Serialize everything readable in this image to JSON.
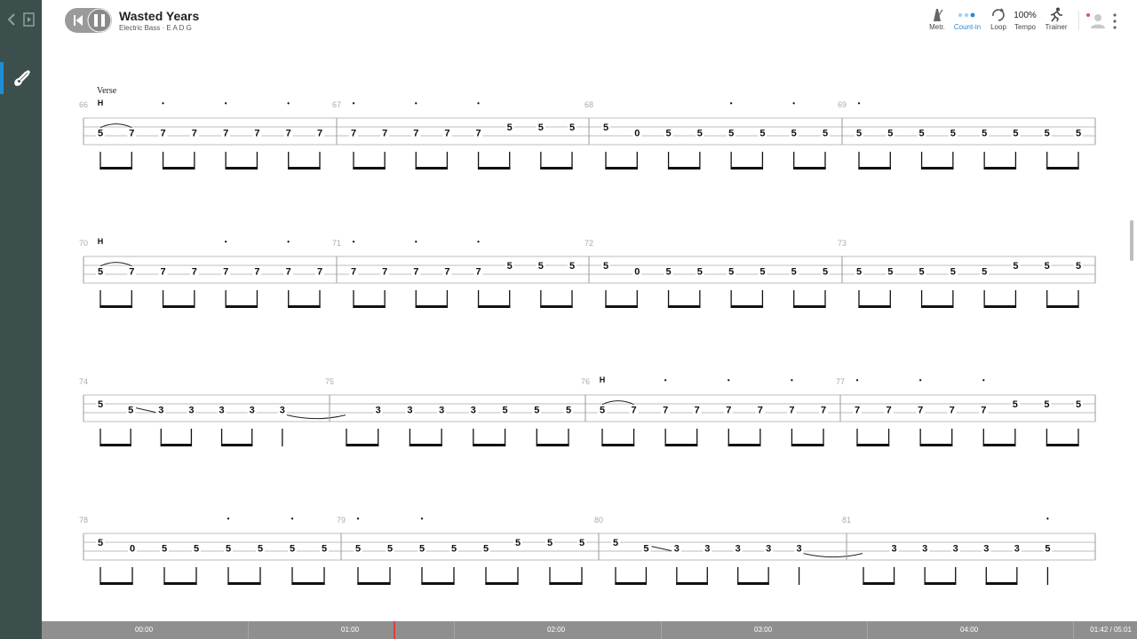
{
  "song": {
    "title": "Wasted Years",
    "subtitle": "Electric Bass · E A D G"
  },
  "toolbar": {
    "metronome": "Metr.",
    "count_in": "Count-in",
    "loop": "Loop",
    "tempo_value": "100%",
    "tempo": "Tempo",
    "trainer": "Trainer"
  },
  "timeline": {
    "labels": [
      "00:00",
      "01:00",
      "02:00",
      "03:00",
      "04:00"
    ],
    "position": "01:42 / 05:01"
  },
  "colors": {
    "sidebar": "#3d4f4c",
    "accent": "#1e8fd6",
    "timeline": "#8f8f8f",
    "playhead": "#e03a3a"
  },
  "icons": [
    "back-arrow-icon",
    "panel-icon",
    "bass-guitar-icon",
    "skip-back-icon",
    "pause-icon",
    "metronome-icon",
    "count-in-icon",
    "loop-icon",
    "trainer-runner-icon",
    "avatar-icon",
    "more-vertical-icon"
  ],
  "score": {
    "systems": [
      {
        "section": "Verse",
        "measures": [
          {
            "number": "66",
            "notes": [
              [
                "5",
                2
              ],
              [
                "7",
                2
              ],
              [
                "7",
                2
              ],
              [
                "7",
                2
              ],
              [
                "7",
                2
              ],
              [
                "7",
                2
              ],
              [
                "7",
                2
              ],
              [
                "7",
                2
              ]
            ],
            "techniques": [
              [
                0,
                "H"
              ],
              [
                2,
                "•"
              ],
              [
                4,
                "•"
              ],
              [
                6,
                "•"
              ]
            ],
            "ties": [
              [
                0,
                1
              ]
            ],
            "beams": [
              2,
              2,
              2,
              2
            ]
          },
          {
            "number": "67",
            "notes": [
              [
                "7",
                2
              ],
              [
                "7",
                2
              ],
              [
                "7",
                2
              ],
              [
                "7",
                2
              ],
              [
                "7",
                2
              ],
              [
                "5",
                1
              ],
              [
                "5",
                1
              ],
              [
                "5",
                1
              ]
            ],
            "techniques": [
              [
                0,
                "•"
              ],
              [
                2,
                "•"
              ],
              [
                4,
                "•"
              ]
            ],
            "beams": [
              2,
              2,
              2,
              2
            ]
          },
          {
            "number": "68",
            "notes": [
              [
                "5",
                1
              ],
              [
                "0",
                2
              ],
              [
                "5",
                2
              ],
              [
                "5",
                2
              ],
              [
                "5",
                2
              ],
              [
                "5",
                2
              ],
              [
                "5",
                2
              ],
              [
                "5",
                2
              ]
            ],
            "techniques": [
              [
                4,
                "•"
              ],
              [
                6,
                "•"
              ]
            ],
            "beams": [
              2,
              2,
              2,
              2
            ]
          },
          {
            "number": "69",
            "notes": [
              [
                "5",
                2
              ],
              [
                "5",
                2
              ],
              [
                "5",
                2
              ],
              [
                "5",
                2
              ],
              [
                "5",
                2
              ],
              [
                "5",
                2
              ],
              [
                "5",
                2
              ],
              [
                "5",
                2
              ]
            ],
            "techniques": [
              [
                0,
                "•"
              ]
            ],
            "beams": [
              2,
              2,
              2,
              2
            ]
          }
        ]
      },
      {
        "measures": [
          {
            "number": "70",
            "notes": [
              [
                "5",
                2
              ],
              [
                "7",
                2
              ],
              [
                "7",
                2
              ],
              [
                "7",
                2
              ],
              [
                "7",
                2
              ],
              [
                "7",
                2
              ],
              [
                "7",
                2
              ],
              [
                "7",
                2
              ]
            ],
            "techniques": [
              [
                0,
                "H"
              ],
              [
                4,
                "•"
              ],
              [
                6,
                "•"
              ]
            ],
            "ties": [
              [
                0,
                1
              ]
            ],
            "beams": [
              2,
              2,
              2,
              2
            ]
          },
          {
            "number": "71",
            "notes": [
              [
                "7",
                2
              ],
              [
                "7",
                2
              ],
              [
                "7",
                2
              ],
              [
                "7",
                2
              ],
              [
                "7",
                2
              ],
              [
                "5",
                1
              ],
              [
                "5",
                1
              ],
              [
                "5",
                1
              ]
            ],
            "techniques": [
              [
                0,
                "•"
              ],
              [
                2,
                "•"
              ],
              [
                4,
                "•"
              ]
            ],
            "beams": [
              2,
              2,
              2,
              2
            ]
          },
          {
            "number": "72",
            "notes": [
              [
                "5",
                1
              ],
              [
                "0",
                2
              ],
              [
                "5",
                2
              ],
              [
                "5",
                2
              ],
              [
                "5",
                2
              ],
              [
                "5",
                2
              ],
              [
                "5",
                2
              ],
              [
                "5",
                2
              ]
            ],
            "techniques": [],
            "beams": [
              2,
              2,
              2,
              2
            ]
          },
          {
            "number": "73",
            "notes": [
              [
                "5",
                2
              ],
              [
                "5",
                2
              ],
              [
                "5",
                2
              ],
              [
                "5",
                2
              ],
              [
                "5",
                2
              ],
              [
                "5",
                1
              ],
              [
                "5",
                1
              ],
              [
                "5",
                1
              ]
            ],
            "techniques": [],
            "beams": [
              2,
              2,
              2,
              2
            ]
          }
        ]
      },
      {
        "measures": [
          {
            "number": "74",
            "notes": [
              [
                "5",
                1
              ],
              [
                "5",
                2
              ],
              [
                "3",
                2
              ],
              [
                "3",
                2
              ],
              [
                "3",
                2
              ],
              [
                "3",
                2
              ],
              [
                "3",
                2
              ]
            ],
            "slots": [
              0,
              1,
              2,
              3,
              4,
              5,
              6
            ],
            "techniques": [],
            "slides": [
              [
                1,
                2
              ]
            ],
            "beams": [
              2,
              2,
              2,
              1
            ],
            "tie_out": 6
          },
          {
            "number": "75",
            "notes": [
              [
                "3",
                2
              ],
              [
                "3",
                2
              ],
              [
                "3",
                2
              ],
              [
                "3",
                2
              ],
              [
                "5",
                2
              ],
              [
                "5",
                2
              ],
              [
                "5",
                2
              ]
            ],
            "slots": [
              1,
              2,
              3,
              4,
              5,
              6,
              7
            ],
            "techniques": [],
            "beams": [
              2,
              2,
              2,
              2
            ]
          },
          {
            "number": "76",
            "notes": [
              [
                "5",
                2
              ],
              [
                "7",
                2
              ],
              [
                "7",
                2
              ],
              [
                "7",
                2
              ],
              [
                "7",
                2
              ],
              [
                "7",
                2
              ],
              [
                "7",
                2
              ],
              [
                "7",
                2
              ]
            ],
            "techniques": [
              [
                0,
                "H"
              ],
              [
                2,
                "•"
              ],
              [
                4,
                "•"
              ],
              [
                6,
                "•"
              ]
            ],
            "ties": [
              [
                0,
                1
              ]
            ],
            "beams": [
              2,
              2,
              2,
              2
            ]
          },
          {
            "number": "77",
            "notes": [
              [
                "7",
                2
              ],
              [
                "7",
                2
              ],
              [
                "7",
                2
              ],
              [
                "7",
                2
              ],
              [
                "7",
                2
              ],
              [
                "5",
                1
              ],
              [
                "5",
                1
              ],
              [
                "5",
                1
              ]
            ],
            "techniques": [
              [
                0,
                "•"
              ],
              [
                2,
                "•"
              ],
              [
                4,
                "•"
              ]
            ],
            "beams": [
              2,
              2,
              2,
              2
            ]
          }
        ]
      },
      {
        "measures": [
          {
            "number": "78",
            "notes": [
              [
                "5",
                1
              ],
              [
                "0",
                2
              ],
              [
                "5",
                2
              ],
              [
                "5",
                2
              ],
              [
                "5",
                2
              ],
              [
                "5",
                2
              ],
              [
                "5",
                2
              ],
              [
                "5",
                2
              ]
            ],
            "techniques": [
              [
                4,
                "•"
              ],
              [
                6,
                "•"
              ]
            ],
            "beams": [
              2,
              2,
              2,
              2
            ]
          },
          {
            "number": "79",
            "notes": [
              [
                "5",
                2
              ],
              [
                "5",
                2
              ],
              [
                "5",
                2
              ],
              [
                "5",
                2
              ],
              [
                "5",
                2
              ],
              [
                "5",
                1
              ],
              [
                "5",
                1
              ],
              [
                "5",
                1
              ]
            ],
            "techniques": [
              [
                0,
                "•"
              ],
              [
                2,
                "•"
              ]
            ],
            "beams": [
              2,
              2,
              2,
              2
            ]
          },
          {
            "number": "80",
            "notes": [
              [
                "5",
                1
              ],
              [
                "5",
                2
              ],
              [
                "3",
                2
              ],
              [
                "3",
                2
              ],
              [
                "3",
                2
              ],
              [
                "3",
                2
              ],
              [
                "3",
                2
              ]
            ],
            "slots": [
              0,
              1,
              2,
              3,
              4,
              5,
              6
            ],
            "techniques": [],
            "slides": [
              [
                1,
                2
              ]
            ],
            "beams": [
              2,
              2,
              2,
              1
            ],
            "tie_out": 6
          },
          {
            "number": "81",
            "notes": [
              [
                "3",
                2
              ],
              [
                "3",
                2
              ],
              [
                "3",
                2
              ],
              [
                "3",
                2
              ],
              [
                "3",
                2
              ],
              [
                "5",
                2
              ]
            ],
            "slots": [
              1,
              2,
              3,
              4,
              5,
              6
            ],
            "techniques": [
              [
                6,
                "•"
              ]
            ],
            "beams": [
              2,
              2,
              2,
              1
            ]
          }
        ]
      }
    ]
  }
}
